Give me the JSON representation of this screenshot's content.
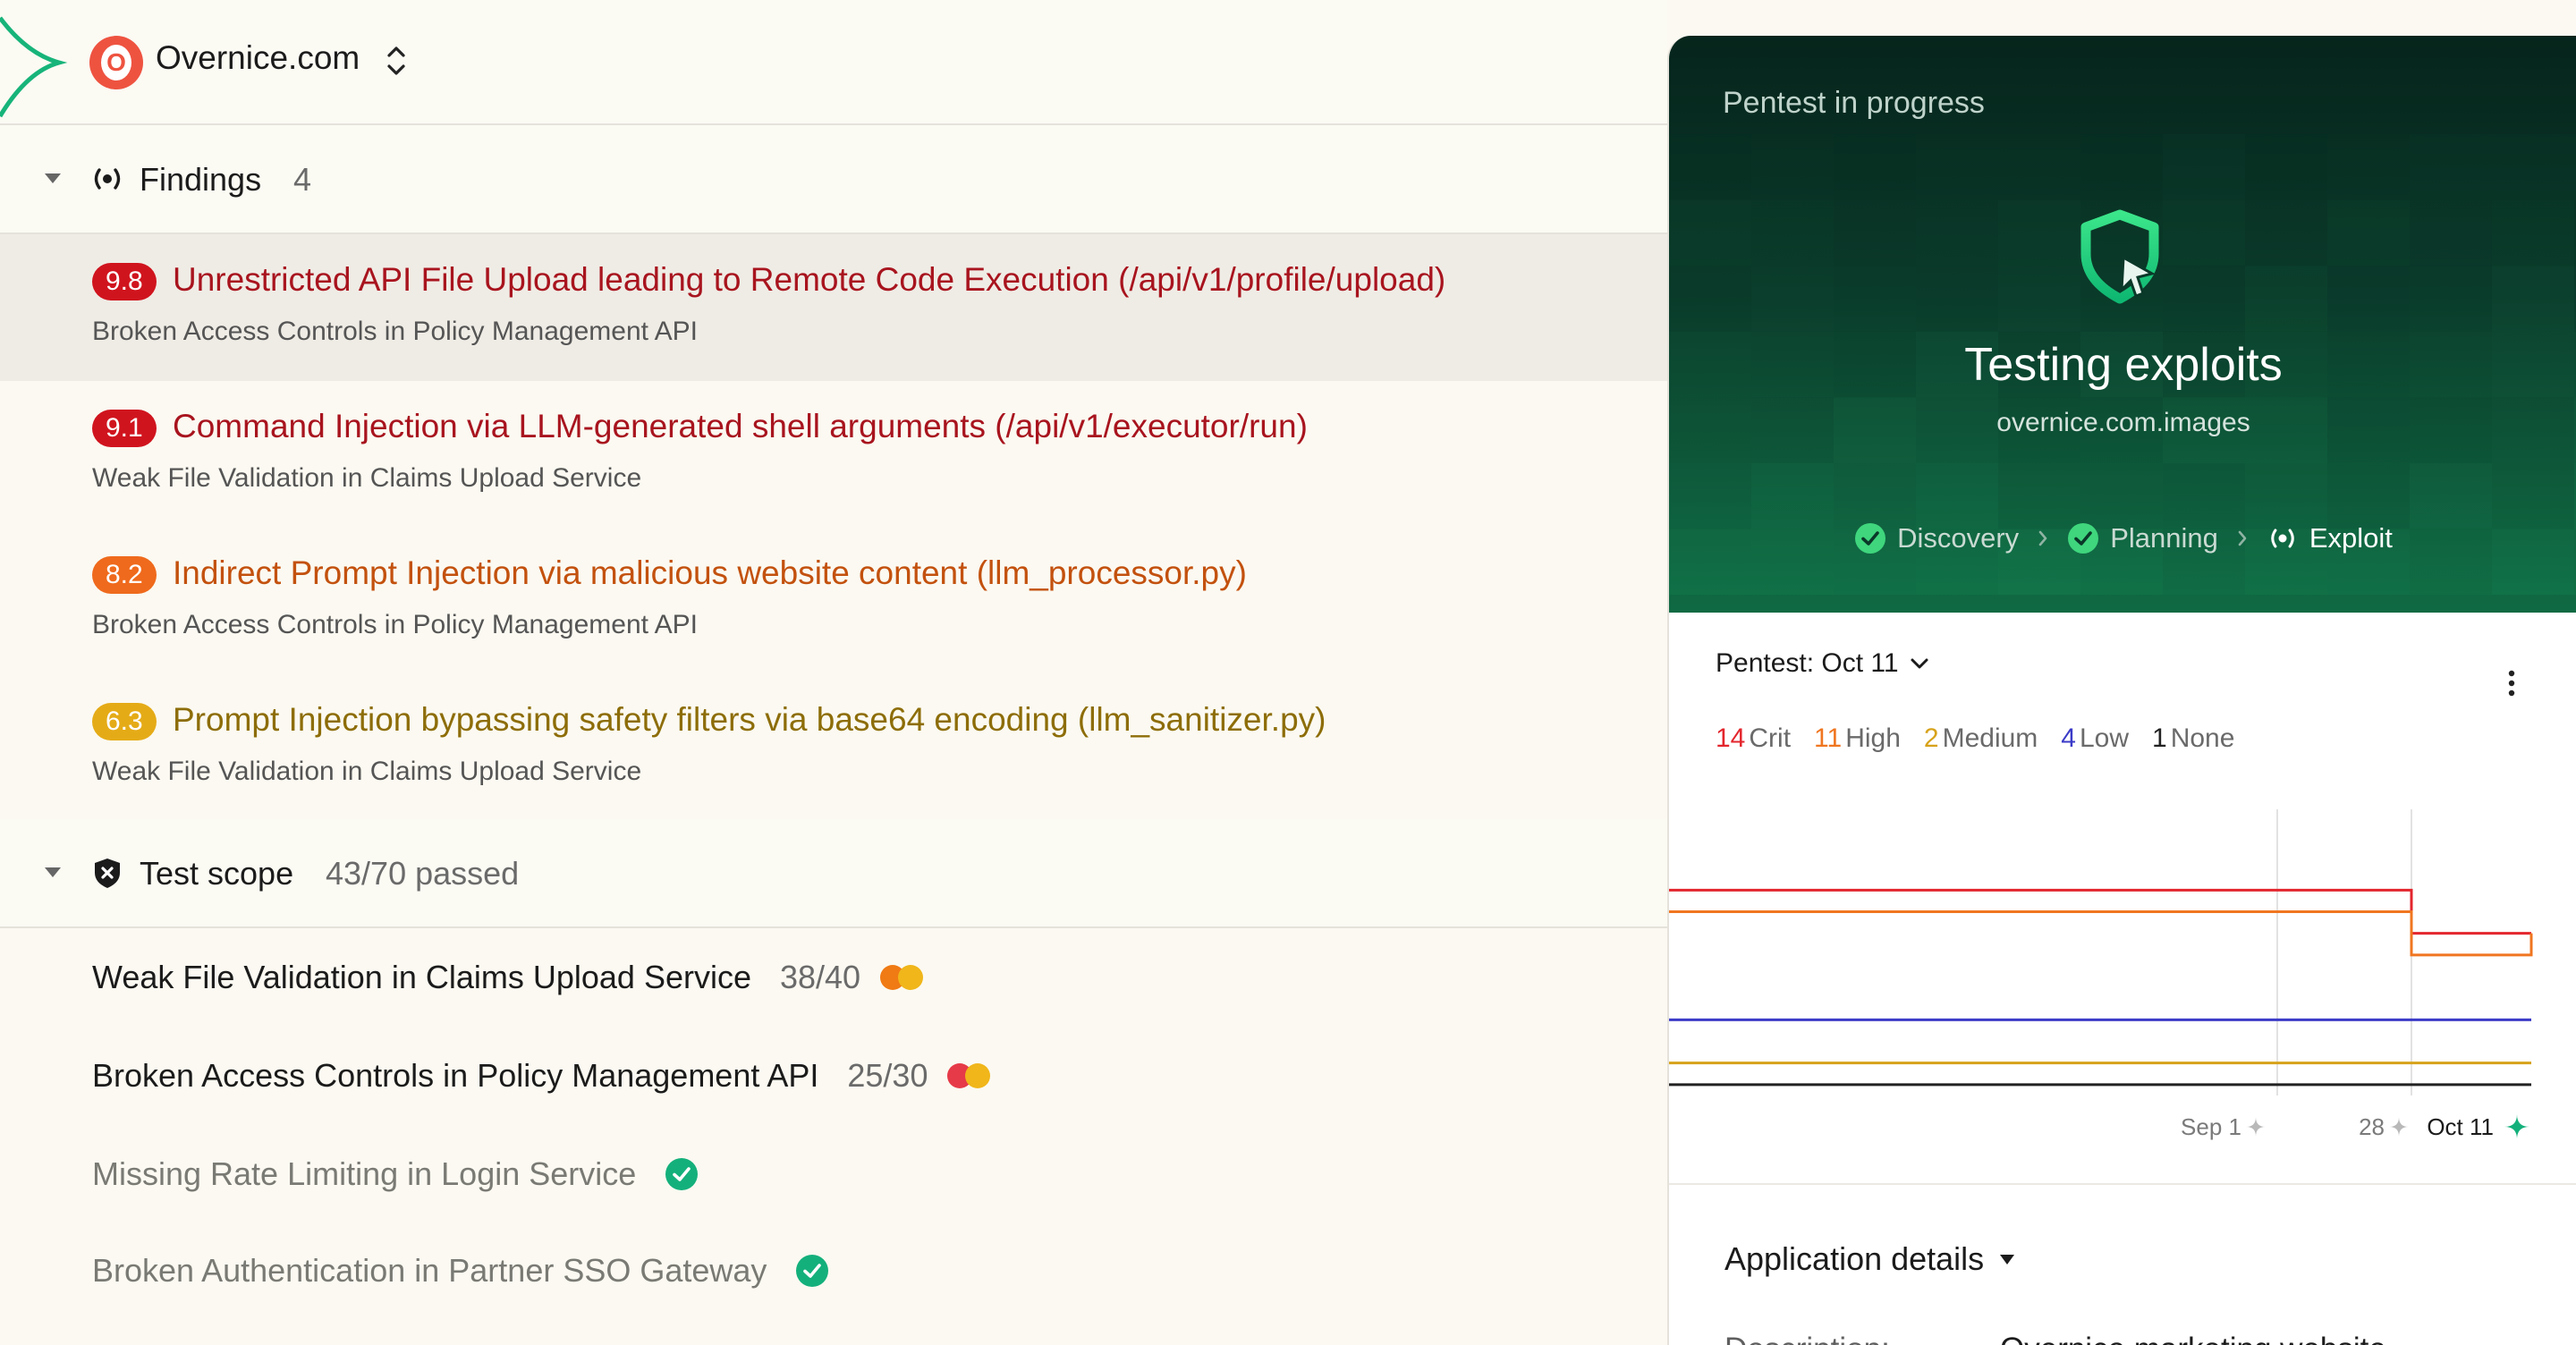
{
  "org": {
    "name": "Overnice.com",
    "logo_letter": "O"
  },
  "findings": {
    "title": "Findings",
    "count": "4",
    "items": [
      {
        "score": "9.8",
        "color": "#d0141e",
        "text_color": "#a8141e",
        "title": "Unrestricted API File Upload leading to Remote Code Execution (/api/v1/profile/upload)",
        "subtitle": "Broken Access Controls in Policy Management API"
      },
      {
        "score": "9.1",
        "color": "#d0141e",
        "text_color": "#a8141e",
        "title": "Command Injection via LLM-generated shell arguments (/api/v1/executor/run)",
        "subtitle": "Weak File Validation in Claims Upload Service"
      },
      {
        "score": "8.2",
        "color": "#ef6a1c",
        "text_color": "#c3510e",
        "title": "Indirect Prompt Injection via malicious website content (llm_processor.py)",
        "subtitle": "Broken Access Controls in Policy Management API"
      },
      {
        "score": "6.3",
        "color": "#e5ab17",
        "text_color": "#8d6d08",
        "title": "Prompt Injection bypassing safety filters via base64 encoding (llm_sanitizer.py)",
        "subtitle": "Weak File Validation in Claims Upload Service"
      }
    ]
  },
  "scope": {
    "title": "Test scope",
    "summary": "43/70 passed",
    "items": [
      {
        "name": "Weak File Validation in Claims Upload Service",
        "score": "38/40",
        "status": "issues",
        "dot1": "#f07a14",
        "dot2": "#f0b61a"
      },
      {
        "name": "Broken Access Controls in Policy Management API",
        "score": "25/30",
        "status": "issues",
        "dot1": "#e63a48",
        "dot2": "#f0b61a"
      },
      {
        "name": "Missing Rate Limiting in Login Service",
        "score": "",
        "status": "passed"
      },
      {
        "name": "Broken Authentication in Partner SSO Gateway",
        "score": "",
        "status": "passed"
      }
    ]
  },
  "pentest": {
    "status": "Pentest in progress",
    "title": "Testing exploits",
    "target": "overnice.com.images",
    "steps": [
      {
        "label": "Discovery",
        "state": "done"
      },
      {
        "label": "Planning",
        "state": "done"
      },
      {
        "label": "Exploit",
        "state": "active"
      }
    ]
  },
  "chart_data": {
    "type": "line",
    "selector": "Pentest: Oct 11",
    "legend": [
      {
        "count": "14",
        "label": "Crit",
        "color": "#e3262d"
      },
      {
        "count": "11",
        "label": "High",
        "color": "#f07620"
      },
      {
        "count": "2",
        "label": "Medium",
        "color": "#d7a21a"
      },
      {
        "count": "4",
        "label": "Low",
        "color": "#3b3bc8"
      },
      {
        "count": "1",
        "label": "None",
        "color": "#222222"
      }
    ],
    "x_ticks": [
      "Sep 1",
      "28",
      "Oct 11"
    ],
    "series": [
      {
        "name": "Crit",
        "color": "#e3262d",
        "values": [
          14,
          14,
          12,
          12
        ]
      },
      {
        "name": "High",
        "color": "#f07620",
        "values": [
          13,
          13,
          11,
          12
        ]
      },
      {
        "name": "Low",
        "color": "#3b3bc8",
        "values": [
          8,
          8,
          8,
          8
        ]
      },
      {
        "name": "Medium",
        "color": "#d7a21a",
        "values": [
          6,
          6,
          6,
          6
        ]
      },
      {
        "name": "None",
        "color": "#222222",
        "values": [
          5,
          5,
          5,
          5
        ]
      }
    ],
    "ylim": [
      4,
      16
    ]
  },
  "details": {
    "title": "Application details",
    "description_label": "Description:",
    "description_value": "Overnice marketing website"
  }
}
